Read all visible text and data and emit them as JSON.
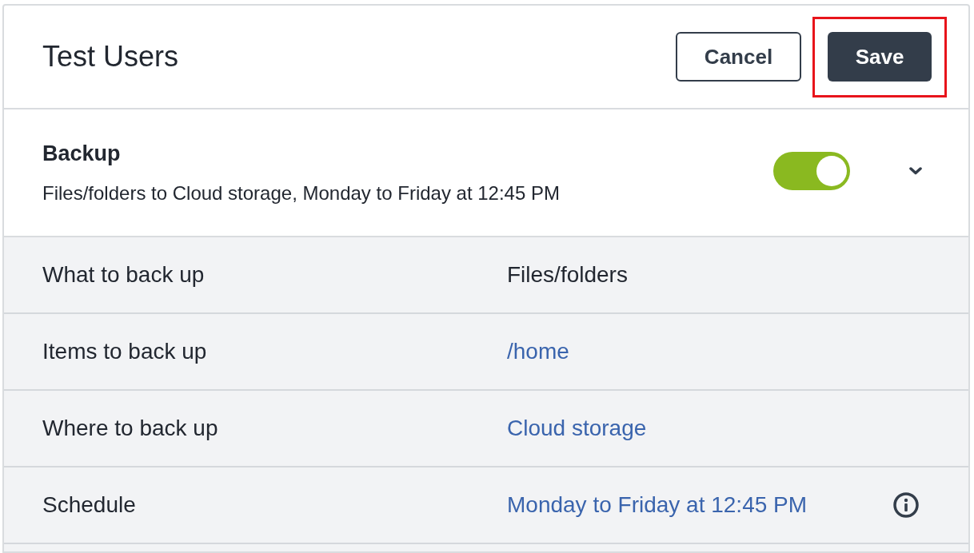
{
  "header": {
    "title": "Test Users",
    "buttons": [
      {
        "label": "Cancel",
        "kind": "secondary",
        "highlighted": false
      },
      {
        "label": "Save",
        "kind": "primary",
        "highlighted": true
      }
    ]
  },
  "backup": {
    "title": "Backup",
    "summary": "Files/folders to Cloud storage, Monday to Friday at 12:45 PM",
    "on": true
  },
  "details": [
    {
      "label": "What to back up",
      "value": "Files/folders",
      "kind": "text",
      "info": false
    },
    {
      "label": "Items to back up",
      "value": "/home",
      "kind": "link",
      "info": false
    },
    {
      "label": "Where to back up",
      "value": "Cloud storage",
      "kind": "link",
      "info": false
    },
    {
      "label": "Schedule",
      "value": "Monday to Friday at 12:45 PM",
      "kind": "link",
      "info": true
    }
  ]
}
